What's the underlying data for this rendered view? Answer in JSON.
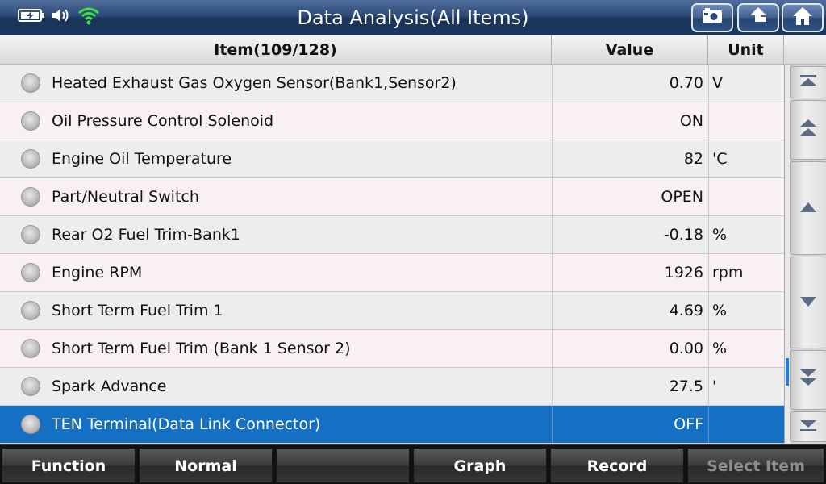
{
  "header": {
    "title": "Data Analysis(All Items)",
    "icons": [
      "battery-icon",
      "speaker-icon",
      "wifi-icon"
    ],
    "buttons": [
      "screenshot-icon",
      "back-icon",
      "home-icon"
    ]
  },
  "table": {
    "columns": {
      "item": "Item(109/128)",
      "value": "Value",
      "unit": "Unit"
    },
    "rows": [
      {
        "name": "Heated Exhaust Gas Oxygen Sensor(Bank1,Sensor2)",
        "value": "0.70",
        "unit": "V"
      },
      {
        "name": "Oil Pressure Control Solenoid",
        "value": "ON",
        "unit": ""
      },
      {
        "name": "Engine Oil Temperature",
        "value": "82",
        "unit": "'C"
      },
      {
        "name": "Part/Neutral Switch",
        "value": "OPEN",
        "unit": ""
      },
      {
        "name": "Rear O2 Fuel Trim-Bank1",
        "value": "-0.18",
        "unit": "%"
      },
      {
        "name": "Engine RPM",
        "value": "1926",
        "unit": "rpm"
      },
      {
        "name": "Short Term Fuel Trim 1",
        "value": "4.69",
        "unit": "%"
      },
      {
        "name": "Short Term Fuel Trim (Bank 1 Sensor 2)",
        "value": "0.00",
        "unit": "%"
      },
      {
        "name": "Spark Advance",
        "value": "27.5",
        "unit": "'"
      },
      {
        "name": "TEN Terminal(Data Link Connector)",
        "value": "OFF",
        "unit": "",
        "selected": true
      }
    ]
  },
  "footer": {
    "buttons": [
      {
        "label": "Function",
        "enabled": true
      },
      {
        "label": "Normal",
        "enabled": true
      },
      {
        "label": "",
        "enabled": true
      },
      {
        "label": "Graph",
        "enabled": true
      },
      {
        "label": "Record",
        "enabled": true
      },
      {
        "label": "Select Item",
        "enabled": false
      }
    ]
  },
  "colors": {
    "selected_row": "#1570c4",
    "header_bar": "#2d4a78",
    "scroll_thumb": "#1b7de0"
  }
}
